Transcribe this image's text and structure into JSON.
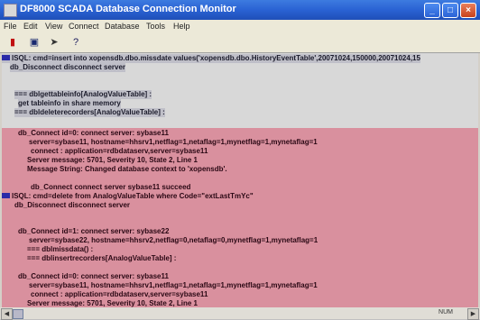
{
  "window": {
    "title": "DF8000 SCADA Database Connection Monitor"
  },
  "menu": [
    "File",
    "Edit",
    "View",
    "Connect",
    "Database",
    "Tools",
    "Help"
  ],
  "toolbar": {
    "buttons": [
      "stop",
      "save",
      "run",
      "help"
    ]
  },
  "log": {
    "gray_lines": [
      "ISQL: cmd=insert into xopensdb.dbo.missdate values('xopensdb.dbo.HistoryEventTable',20071024,150000,20071024,15",
      "db_Disconnect disconnect server",
      "=== dblgettableinfo[AnalogValueTable] :",
      "get tableinfo in share memory",
      "=== dbldeleterecorders[AnalogValueTable] :"
    ],
    "pink_lines": [
      "db_Connect id=0: connect server: sybase11",
      "server=sybase11, hostname=hhsrv1,netflag=1,netaflag=1,mynetflag=1,mynetaflag=1",
      "connect : application=rdbdataserv,server=sybase11",
      "Server message: 5701, Severity 10, State 2, Line 1",
      "Message String: Changed database context to 'xopensdb'.",
      "db_Connect connect server sybase11 succeed",
      "ISQL: cmd=delete from AnalogValueTable where Code=\"extLastTmYc\"",
      "db_Disconnect disconnect server",
      "db_Connect id=1: connect server: sybase22",
      "server=sybase22, hostname=hhsrv2,netflag=0,netaflag=0,mynetflag=1,mynetaflag=1",
      "=== dblmissdata() :",
      "=== dblinsertrecorders[AnalogValueTable] :",
      "db_Connect id=0: connect server: sybase11",
      "server=sybase11, hostname=hhsrv1,netflag=1,netaflag=1,mynetflag=1,mynetaflag=1",
      "connect : application=rdbdataserv,server=sybase11",
      "Server message: 5701, Severity 10, State 2, Line 1"
    ]
  },
  "statusbar": {
    "text": "NUM"
  },
  "colors": {
    "log_highlight": "#d9909e",
    "log_background": "#d8d8d8",
    "title_bar": "#2a62d3"
  }
}
